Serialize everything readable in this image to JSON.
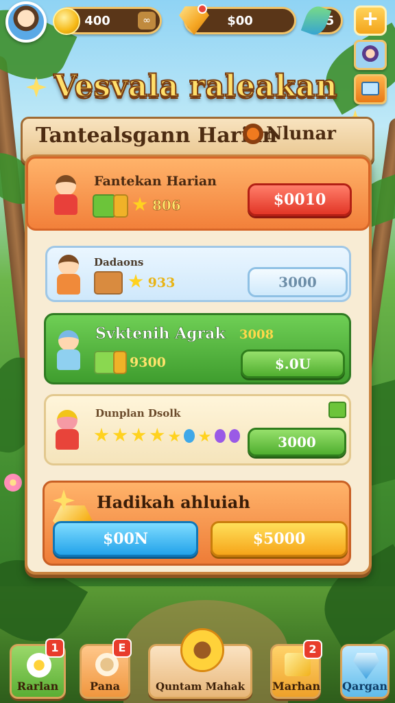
{
  "top_bar": {
    "coins": "400",
    "coins_action": "∞",
    "gems": "$00",
    "energy": "5",
    "plus_label": "+"
  },
  "title": "Vesvala raleakan",
  "header": {
    "subtitle": "Tantealsgann Harian",
    "status": "Nlunar"
  },
  "rows": [
    {
      "label": "Fantekan Harian",
      "reward": "806",
      "button": "$0010"
    },
    {
      "label": "Dadaons",
      "reward": "933",
      "button": "3000"
    },
    {
      "label": "Svktenih Agrak",
      "bonus": "3008",
      "reward": "9300",
      "button": "$.0U"
    },
    {
      "label": "Dunplan Dsolk",
      "button": "3000"
    }
  ],
  "reward_box": {
    "label": "Hadikah ahluiah",
    "button_left": "$00N",
    "button_right": "$5000"
  },
  "bottom_nav": [
    {
      "label": "Rarlan",
      "badge": "1"
    },
    {
      "label": "Pana",
      "badge": "E"
    },
    {
      "label": "Quntam Mahak"
    },
    {
      "label": "Marhan",
      "badge": "2"
    },
    {
      "label": "Qargan"
    }
  ],
  "colors": {
    "accent_orange": "#f2803a",
    "button_red": "#e23626",
    "button_green": "#4fae2f",
    "button_blue": "#23a3ea",
    "button_gold": "#f6a51a",
    "title_gold": "#ffdf6b"
  },
  "icons": {
    "coin": "coin-icon",
    "gem": "gem-icon",
    "energy": "feather-icon",
    "plus": "plus-icon"
  }
}
